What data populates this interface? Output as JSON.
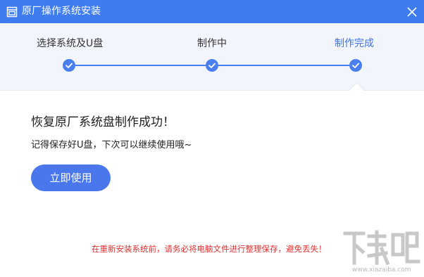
{
  "window": {
    "title": "原厂操作系统安装",
    "icon": "installer-window-icon",
    "close_icon": "close-icon"
  },
  "steps": [
    {
      "label": "选择系统及U盘",
      "state": "done"
    },
    {
      "label": "制作中",
      "state": "done"
    },
    {
      "label": "制作完成",
      "state": "current"
    }
  ],
  "content": {
    "title": "恢复原厂系统盘制作成功！",
    "description": "记得保存好U盘，下次可以继续使用哦~",
    "use_button_label": "立即使用",
    "warning": "在重新安装系统前，请务必将电脑文件进行整理保存，避免丢失！"
  },
  "watermark": {
    "url": "www.xiazaiba.com"
  },
  "colors": {
    "titlebar": "#3f7cf0",
    "accent": "#4a7fef",
    "warning": "#e03030"
  }
}
